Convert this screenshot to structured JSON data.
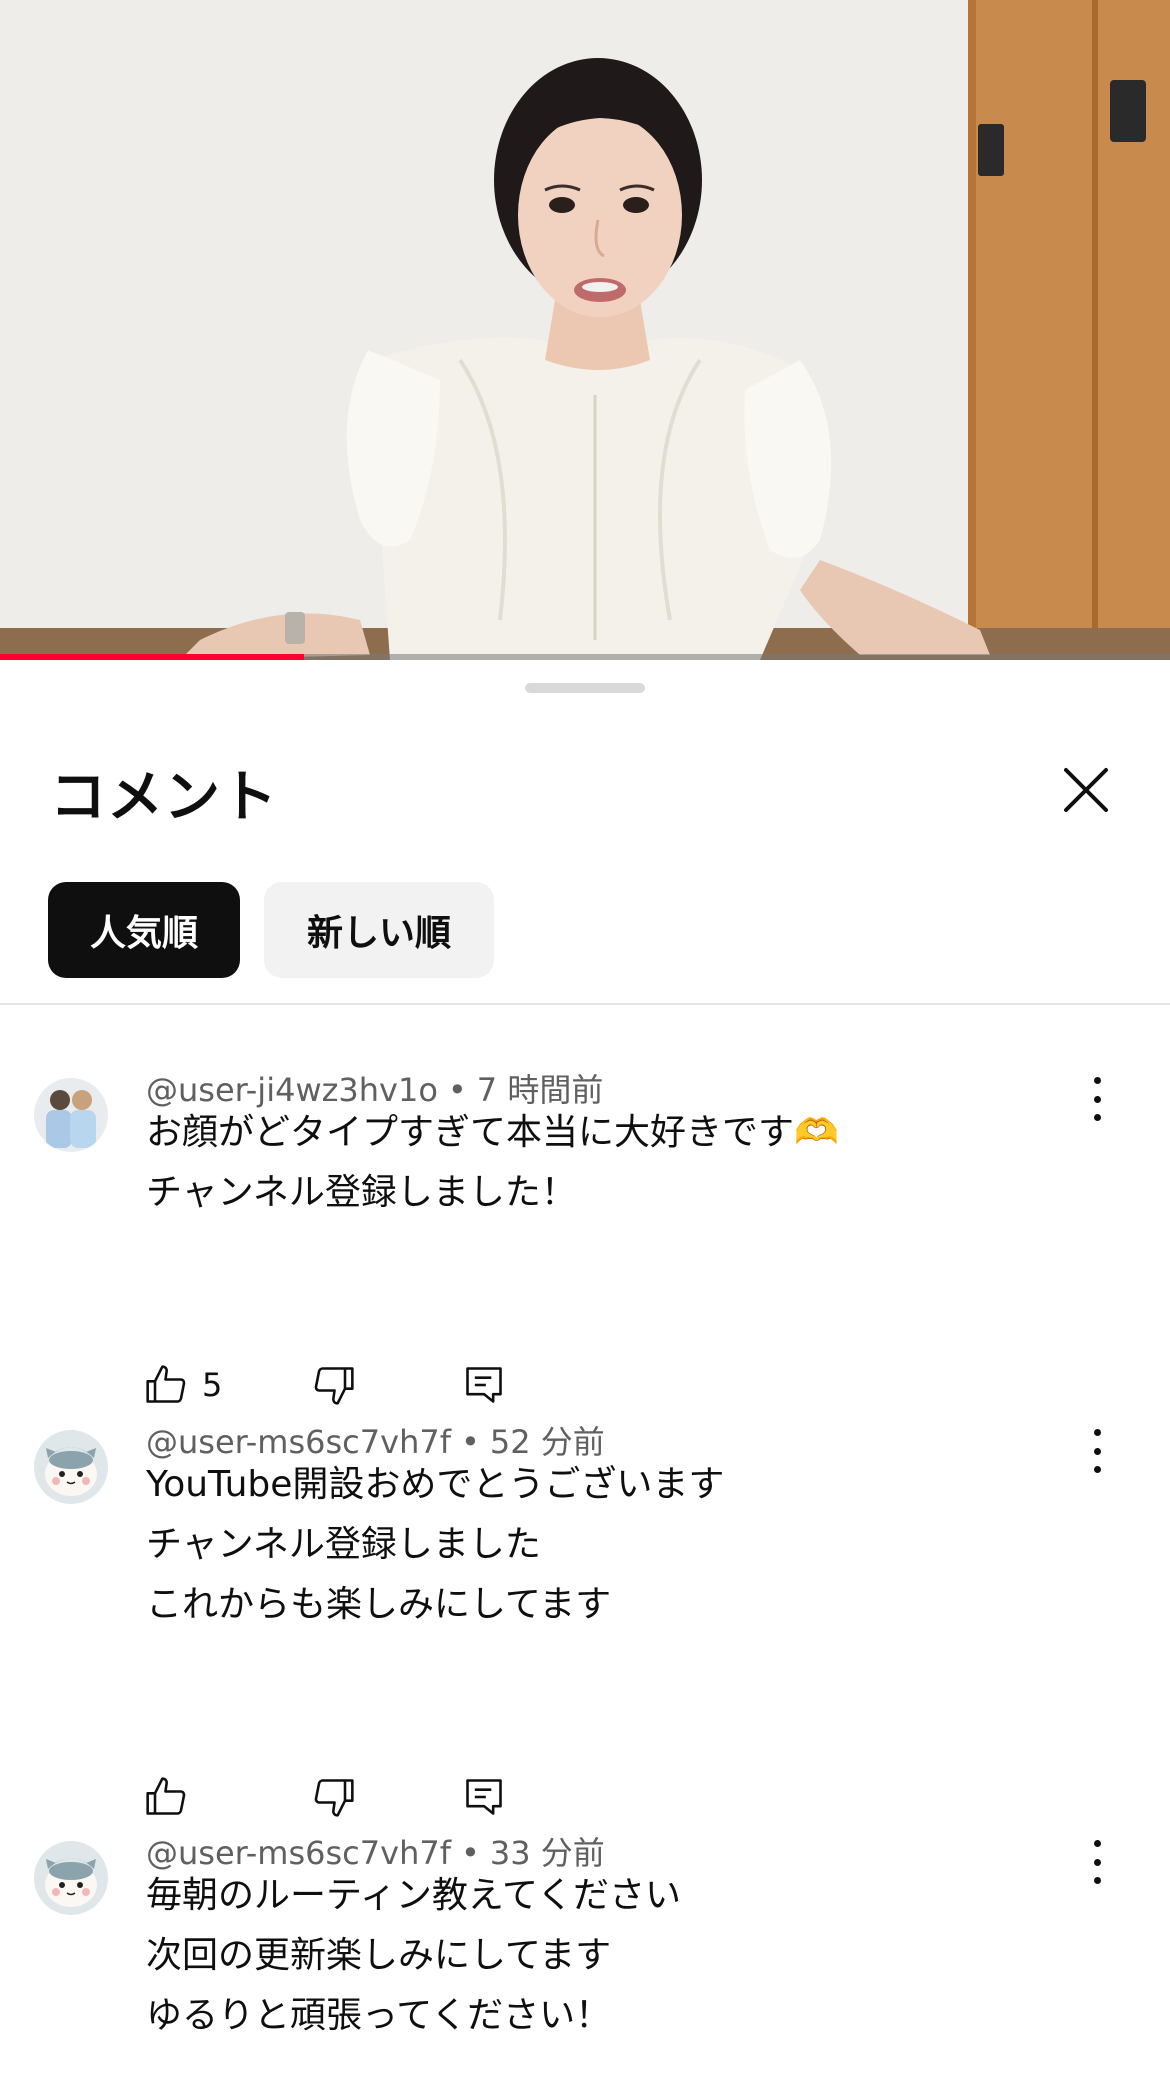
{
  "video": {
    "progress_fraction": 0.26,
    "progress_color": "#ff0033"
  },
  "sheet": {
    "title": "コメント",
    "close_icon": "close-icon",
    "sort_chips": [
      {
        "label": "人気順",
        "selected": true
      },
      {
        "label": "新しい順",
        "selected": false
      }
    ]
  },
  "comments": [
    {
      "author": "@user-ji4wz3hv1o",
      "separator": "•",
      "time": "7 時間前",
      "lines": [
        "お顔がどタイプすぎて本当に大好きです🫶",
        "チャンネル登録しました！"
      ],
      "likes": "5",
      "avatar": "photo-avatar"
    },
    {
      "author": "@user-ms6sc7vh7f",
      "separator": "•",
      "time": "52 分前",
      "lines": [
        "YouTube開設おめでとうございます",
        "チャンネル登録しました",
        "これからも楽しみにしてます"
      ],
      "likes": "",
      "avatar": "cartoon-cat-avatar"
    },
    {
      "author": "@user-ms6sc7vh7f",
      "separator": "•",
      "time": "33 分前",
      "lines": [
        "毎朝のルーティン教えてください",
        "次回の更新楽しみにしてます",
        "ゆるりと頑張ってください！"
      ],
      "likes": "",
      "avatar": "cartoon-cat-avatar"
    }
  ]
}
